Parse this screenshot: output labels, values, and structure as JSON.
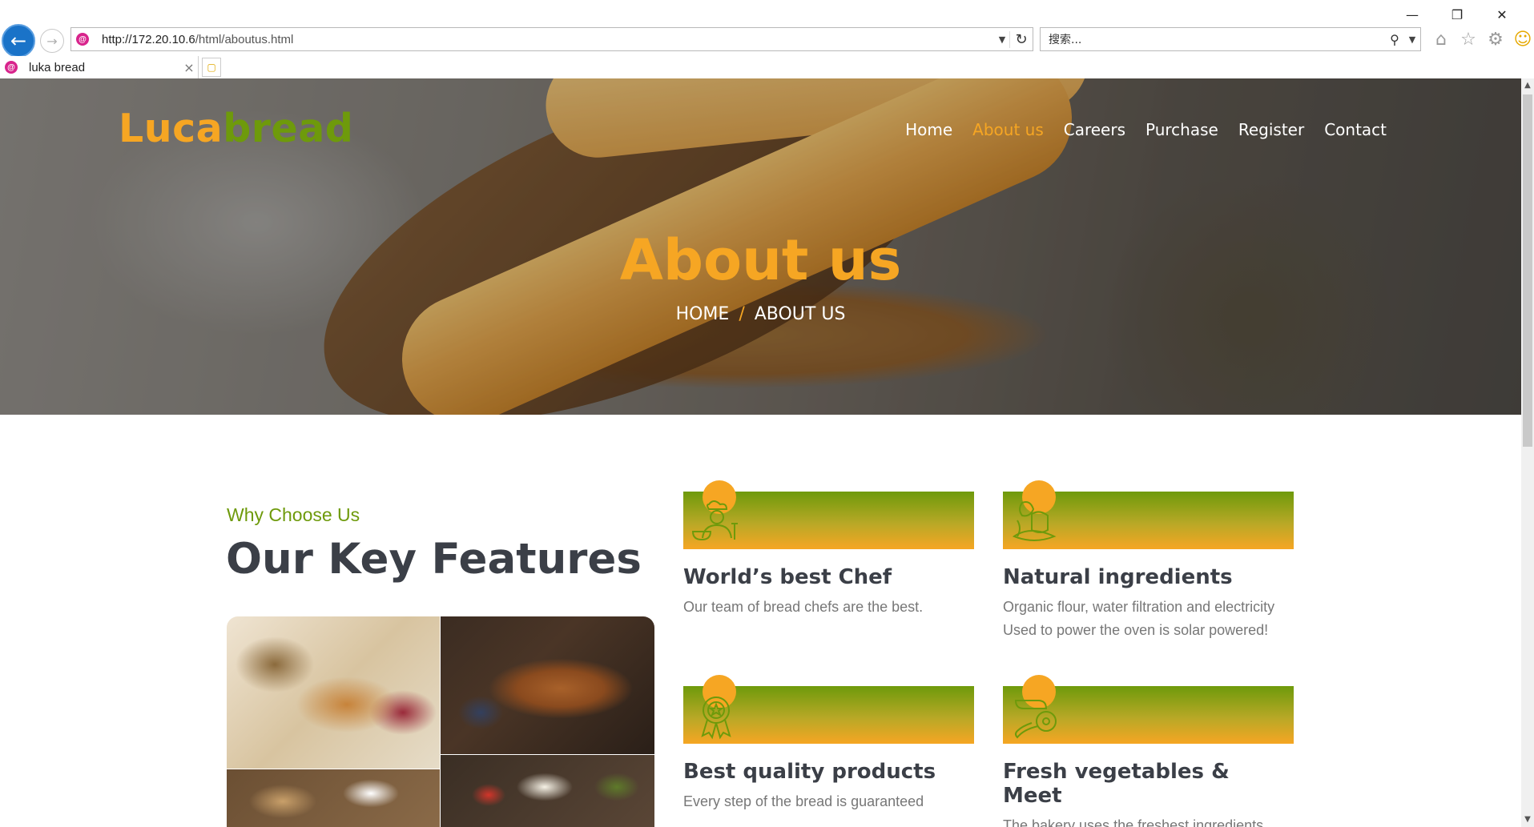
{
  "browser": {
    "url_host": "http://172.20.10.6",
    "url_path": "/html/aboutus.html",
    "search_placeholder": "搜索...",
    "tab_title": "luka bread",
    "tab_close": "×"
  },
  "site": {
    "logo_part1": "Luca",
    "logo_part2": "bread",
    "nav": [
      "Home",
      "About us",
      "Careers",
      "Purchase",
      "Register",
      "Contact"
    ],
    "active_nav": "About us",
    "hero_title": "About us",
    "crumb_home": "HOME",
    "crumb_sep": "/",
    "crumb_current": "ABOUT US"
  },
  "features": {
    "eyebrow": "Why Choose Us",
    "heading": "Our Key Features",
    "items": [
      {
        "title": "World’s best Chef",
        "desc": "Our team of bread chefs are the best.",
        "icon": "chef-icon"
      },
      {
        "title": "Natural ingredients",
        "desc": "Organic flour, water filtration and electricity Used to power the oven is solar powered!",
        "icon": "vegetables-icon"
      },
      {
        "title": "Best quality products",
        "desc": "Every step of the bread is guaranteed",
        "icon": "award-badge-icon"
      },
      {
        "title": "Fresh vegetables & Meet",
        "desc": "The bakery uses the freshest ingredients",
        "icon": "meat-icon"
      }
    ]
  },
  "colors": {
    "accent_orange": "#f6a623",
    "accent_green": "#6e9a0b",
    "heading_dark": "#3b3f47"
  }
}
